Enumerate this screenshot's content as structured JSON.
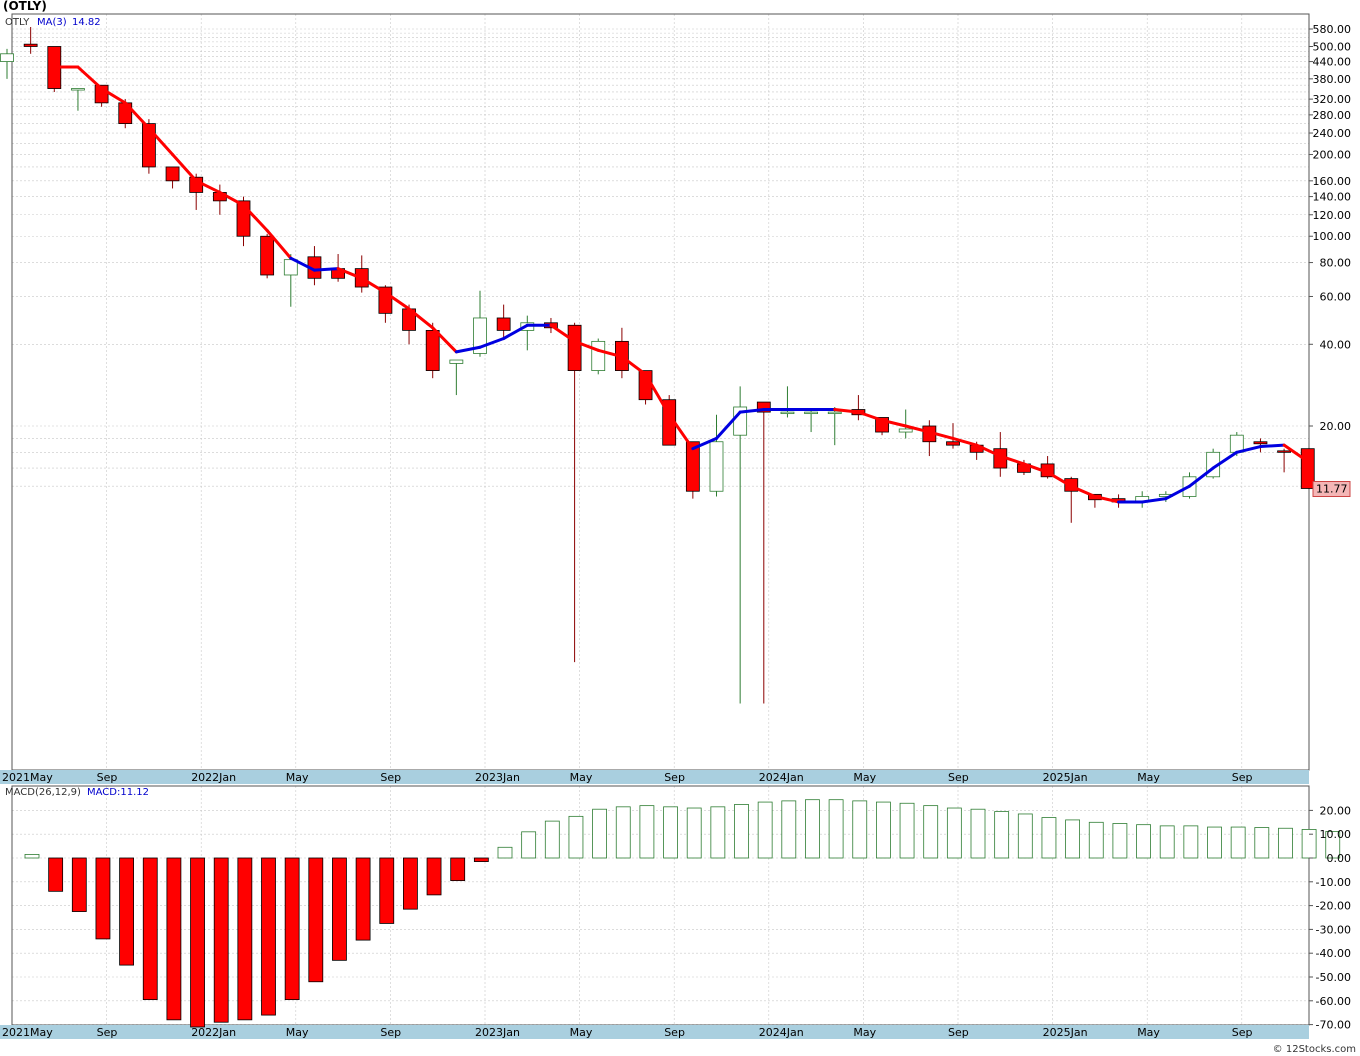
{
  "title": "(OTLY)",
  "legend": {
    "symbol": "OTLY",
    "ma_label": "MA(3)",
    "ma_value": "14.82",
    "macd_label": "MACD(26,12,9)",
    "macd_value_label": "MACD:11.12"
  },
  "last_price_label": "11.77",
  "footer": "© 12Stocks.com",
  "colors": {
    "up": "#2e7d32",
    "down": "#ff0000",
    "ma_down": "#ff0000",
    "ma_up": "#0000e0",
    "axis_band": "#a9cfdf",
    "grid": "#c8c8c8",
    "price_tag_bg": "#f4b6b6"
  },
  "chart_data": [
    {
      "type": "candlestick",
      "scale": "log",
      "y_ticks": [
        580,
        500,
        440,
        380,
        320,
        280,
        240,
        200,
        160,
        140,
        120,
        100,
        80,
        60,
        40,
        20
      ],
      "y_tick_labels": [
        "580.00",
        "500.00",
        "440.00",
        "380.00",
        "320.00",
        "280.00",
        "240.00",
        "200.00",
        "160.00",
        "140.00",
        "120.00",
        "100.00",
        "80.00",
        "60.00",
        "40.00",
        "20.00"
      ],
      "x_labels": [
        "2021May",
        "Sep",
        "2022Jan",
        "May",
        "Sep",
        "2023Jan",
        "May",
        "Sep",
        "2024Jan",
        "May",
        "Sep",
        "2025Jan",
        "May",
        "Sep"
      ],
      "x_label_months": [
        0,
        4,
        8,
        12,
        16,
        20,
        24,
        28,
        32,
        36,
        40,
        44,
        48,
        52
      ],
      "grid": true,
      "ohlc": [
        [
          440,
          490,
          380,
          470
        ],
        [
          510,
          590,
          470,
          500
        ],
        [
          500,
          500,
          340,
          350
        ],
        [
          350,
          350,
          290,
          350
        ],
        [
          360,
          360,
          300,
          310
        ],
        [
          310,
          320,
          250,
          260
        ],
        [
          260,
          270,
          170,
          180
        ],
        [
          180,
          180,
          150,
          160
        ],
        [
          165,
          170,
          125,
          145
        ],
        [
          145,
          155,
          120,
          135
        ],
        [
          135,
          140,
          92,
          100
        ],
        [
          100,
          102,
          70,
          72
        ],
        [
          72,
          86,
          55,
          82
        ],
        [
          84,
          92,
          66,
          70
        ],
        [
          76,
          86,
          68,
          70
        ],
        [
          76,
          85,
          62,
          65
        ],
        [
          65,
          66,
          48,
          52
        ],
        [
          54,
          56,
          40,
          45
        ],
        [
          45,
          48,
          30,
          32
        ],
        [
          34,
          35,
          26,
          35
        ],
        [
          37,
          63,
          36,
          50
        ],
        [
          50,
          56,
          42,
          45
        ],
        [
          45,
          51,
          38,
          48
        ],
        [
          48,
          50,
          44,
          46
        ],
        [
          47,
          48,
          2.7,
          32
        ],
        [
          32,
          42,
          31,
          41
        ],
        [
          41,
          46,
          30,
          32
        ],
        [
          32,
          32,
          24,
          25
        ],
        [
          25,
          26,
          17,
          17
        ],
        [
          17.5,
          17.5,
          10.8,
          11.5
        ],
        [
          11.5,
          22,
          11,
          17.5
        ],
        [
          18.5,
          28,
          1.9,
          23.5
        ],
        [
          24.5,
          24.5,
          1.9,
          22.5
        ],
        [
          22.5,
          28,
          21.5,
          22.5
        ],
        [
          22.5,
          23,
          19,
          22.5
        ],
        [
          22.5,
          23.5,
          17,
          22.5
        ],
        [
          23,
          26,
          21,
          22
        ],
        [
          21.5,
          21.5,
          18.5,
          19
        ],
        [
          19,
          23,
          18,
          19.5
        ],
        [
          20,
          21,
          15.5,
          17.5
        ],
        [
          17.5,
          20.5,
          16.5,
          17
        ],
        [
          17,
          17.5,
          15,
          16
        ],
        [
          16.5,
          19,
          13,
          14
        ],
        [
          14.5,
          15,
          13.2,
          13.5
        ],
        [
          14.5,
          15.5,
          12.8,
          13
        ],
        [
          12.8,
          13,
          8.8,
          11.5
        ],
        [
          11.2,
          11.2,
          10,
          10.7
        ],
        [
          10.8,
          11.2,
          10,
          10.5
        ],
        [
          10.5,
          11.5,
          10,
          11
        ],
        [
          11,
          11.5,
          10.5,
          11.2
        ],
        [
          11,
          13.5,
          10.8,
          13
        ],
        [
          13,
          16.5,
          12.8,
          16
        ],
        [
          16,
          19,
          15.5,
          18.5
        ],
        [
          17.5,
          18,
          16,
          17.2
        ],
        [
          16.2,
          16.5,
          13.5,
          16
        ],
        [
          16.5,
          16.5,
          11.77,
          11.77
        ]
      ],
      "ma": [
        null,
        null,
        420,
        420,
        350,
        310,
        250,
        200,
        160,
        145,
        130,
        105,
        83,
        75,
        76,
        70,
        62,
        54,
        46,
        37.5,
        39,
        42,
        47,
        47,
        41,
        38,
        36,
        31,
        22,
        16.5,
        18,
        22.5,
        23,
        23,
        23,
        23,
        22.5,
        21,
        20,
        19,
        18,
        17,
        15.5,
        14.5,
        13.5,
        12,
        11,
        10.5,
        10.5,
        10.8,
        12,
        14,
        16,
        16.8,
        17,
        14.82
      ],
      "ma_up": [
        false,
        false,
        false,
        false,
        false,
        false,
        false,
        false,
        false,
        false,
        false,
        false,
        false,
        true,
        true,
        false,
        false,
        false,
        false,
        false,
        true,
        true,
        true,
        true,
        false,
        false,
        false,
        false,
        false,
        false,
        true,
        true,
        true,
        true,
        true,
        true,
        false,
        false,
        false,
        false,
        false,
        false,
        false,
        false,
        false,
        false,
        false,
        false,
        true,
        true,
        true,
        true,
        true,
        true,
        true,
        false
      ]
    },
    {
      "type": "bar",
      "title": "MACD(26,12,9)",
      "y_ticks": [
        20,
        10,
        0,
        -10,
        -20,
        -30,
        -40,
        -50,
        -60,
        -70
      ],
      "y_tick_labels": [
        "20.00",
        "10.00",
        "0.00",
        "-10.00",
        "-20.00",
        "-30.00",
        "-40.00",
        "-50.00",
        "-60.00",
        "-70.00"
      ],
      "x_labels": [
        "2021May",
        "Sep",
        "2022Jan",
        "May",
        "Sep",
        "2023Jan",
        "May",
        "Sep",
        "2024Jan",
        "May",
        "Sep",
        "2025Jan",
        "May",
        "Sep"
      ],
      "x_label_months": [
        0,
        4,
        8,
        12,
        16,
        20,
        24,
        28,
        32,
        36,
        40,
        44,
        48,
        52
      ],
      "values": [
        1.5,
        -14,
        -22.5,
        -34,
        -45,
        -59.5,
        -68,
        -71,
        -69,
        -68,
        -66,
        -59.5,
        -52,
        -43,
        -34.5,
        -27.5,
        -21.5,
        -15.5,
        -9.5,
        -1.5,
        4.5,
        11,
        15.5,
        17.5,
        20.5,
        21.5,
        22,
        21.5,
        21,
        21.5,
        22.5,
        23.5,
        24,
        24.5,
        24.5,
        24,
        23.5,
        23,
        22,
        21,
        20.5,
        19.5,
        18.5,
        17,
        16,
        15,
        14.5,
        14,
        13.5,
        13.5,
        13,
        13,
        12.8,
        12.5,
        12,
        11.12
      ]
    }
  ]
}
